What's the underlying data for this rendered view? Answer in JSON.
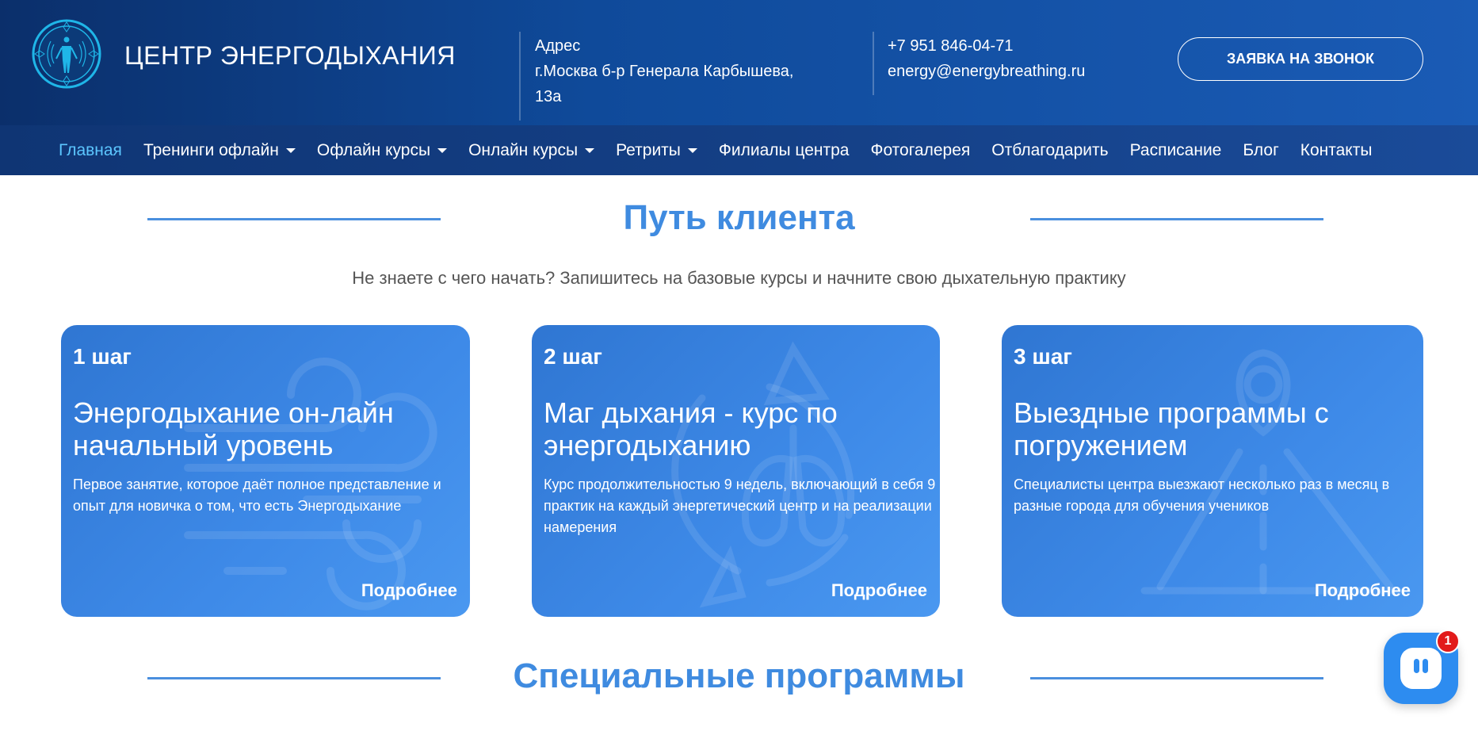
{
  "header": {
    "brand": "ЦЕНТР ЭНЕРГОДЫХАНИЯ",
    "address_label": "Адрес",
    "address_line1": "г.Москва б-р Генерала Карбышева,",
    "address_line2": "13а",
    "phone": "+7 951 846-04-71",
    "email": "energy@energybreathing.ru",
    "call_button": "ЗАЯВКА НА ЗВОНОК"
  },
  "nav": {
    "items": [
      {
        "label": "Главная",
        "dropdown": false,
        "active": true
      },
      {
        "label": "Тренинги офлайн",
        "dropdown": true
      },
      {
        "label": "Офлайн курсы",
        "dropdown": true
      },
      {
        "label": "Онлайн курсы",
        "dropdown": true
      },
      {
        "label": "Ретриты",
        "dropdown": true
      },
      {
        "label": "Филиалы центра",
        "dropdown": false
      },
      {
        "label": "Фотогалерея",
        "dropdown": false
      },
      {
        "label": "Отблагодарить",
        "dropdown": false
      },
      {
        "label": "Расписание",
        "dropdown": false
      },
      {
        "label": "Блог",
        "dropdown": false
      },
      {
        "label": "Контакты",
        "dropdown": false
      }
    ]
  },
  "section1": {
    "title": "Путь клиента",
    "subtitle": "Не знаете с чего начать? Запишитесь на базовые курсы и начните свою дыхательную практику"
  },
  "cards": [
    {
      "step": "1 шаг",
      "title": "Энергодыхание он-лайн начальный уровень",
      "desc": "Первое занятие, которое даёт полное представление и опыт для новичка о том, что есть Энергодыхание",
      "more": "Подробнее",
      "icon": "wind-icon"
    },
    {
      "step": "2 шаг",
      "title": "Маг дыхания - курс по энергодыханию",
      "desc": "Курс продолжительностью 9 недель, включающий в себя 9 практик на каждый энергетический центр и на реализации намерения",
      "more": "Подробнее",
      "icon": "lungs-cycle-icon"
    },
    {
      "step": "3 шаг",
      "title": "Выездные программы с погружением",
      "desc": "Специалисты центра выезжают несколько раз в месяц в разные города для обучения учеников",
      "more": "Подробнее",
      "icon": "road-pin-icon"
    }
  ],
  "section2": {
    "title": "Специальные программы"
  },
  "chat": {
    "badge": "1"
  },
  "colors": {
    "accent": "#3f8be0",
    "header_dark": "#0b2f6b",
    "card_blue": "#3e8ae8",
    "active_nav": "#5cc6ff",
    "badge_red": "#e21b1b"
  }
}
